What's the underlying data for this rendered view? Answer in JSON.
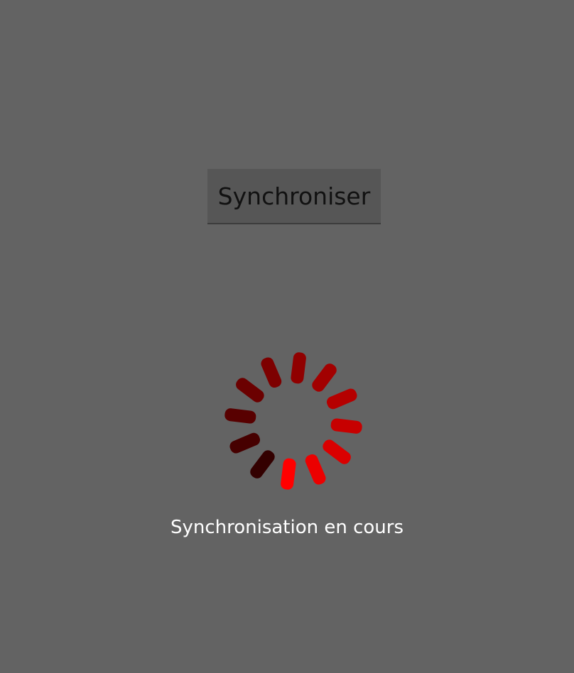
{
  "app": {
    "sync_button_label": "Synchroniser",
    "status_text": "Synchronisation en cours"
  },
  "spinner": {
    "icon": "loading-spinner-icon",
    "segments": 12,
    "head_color": "#ff0000",
    "tail_color": "#330000"
  },
  "colors": {
    "background": "#636363",
    "button_background": "#565656",
    "button_text": "#111111",
    "status_text": "#ffffff"
  }
}
